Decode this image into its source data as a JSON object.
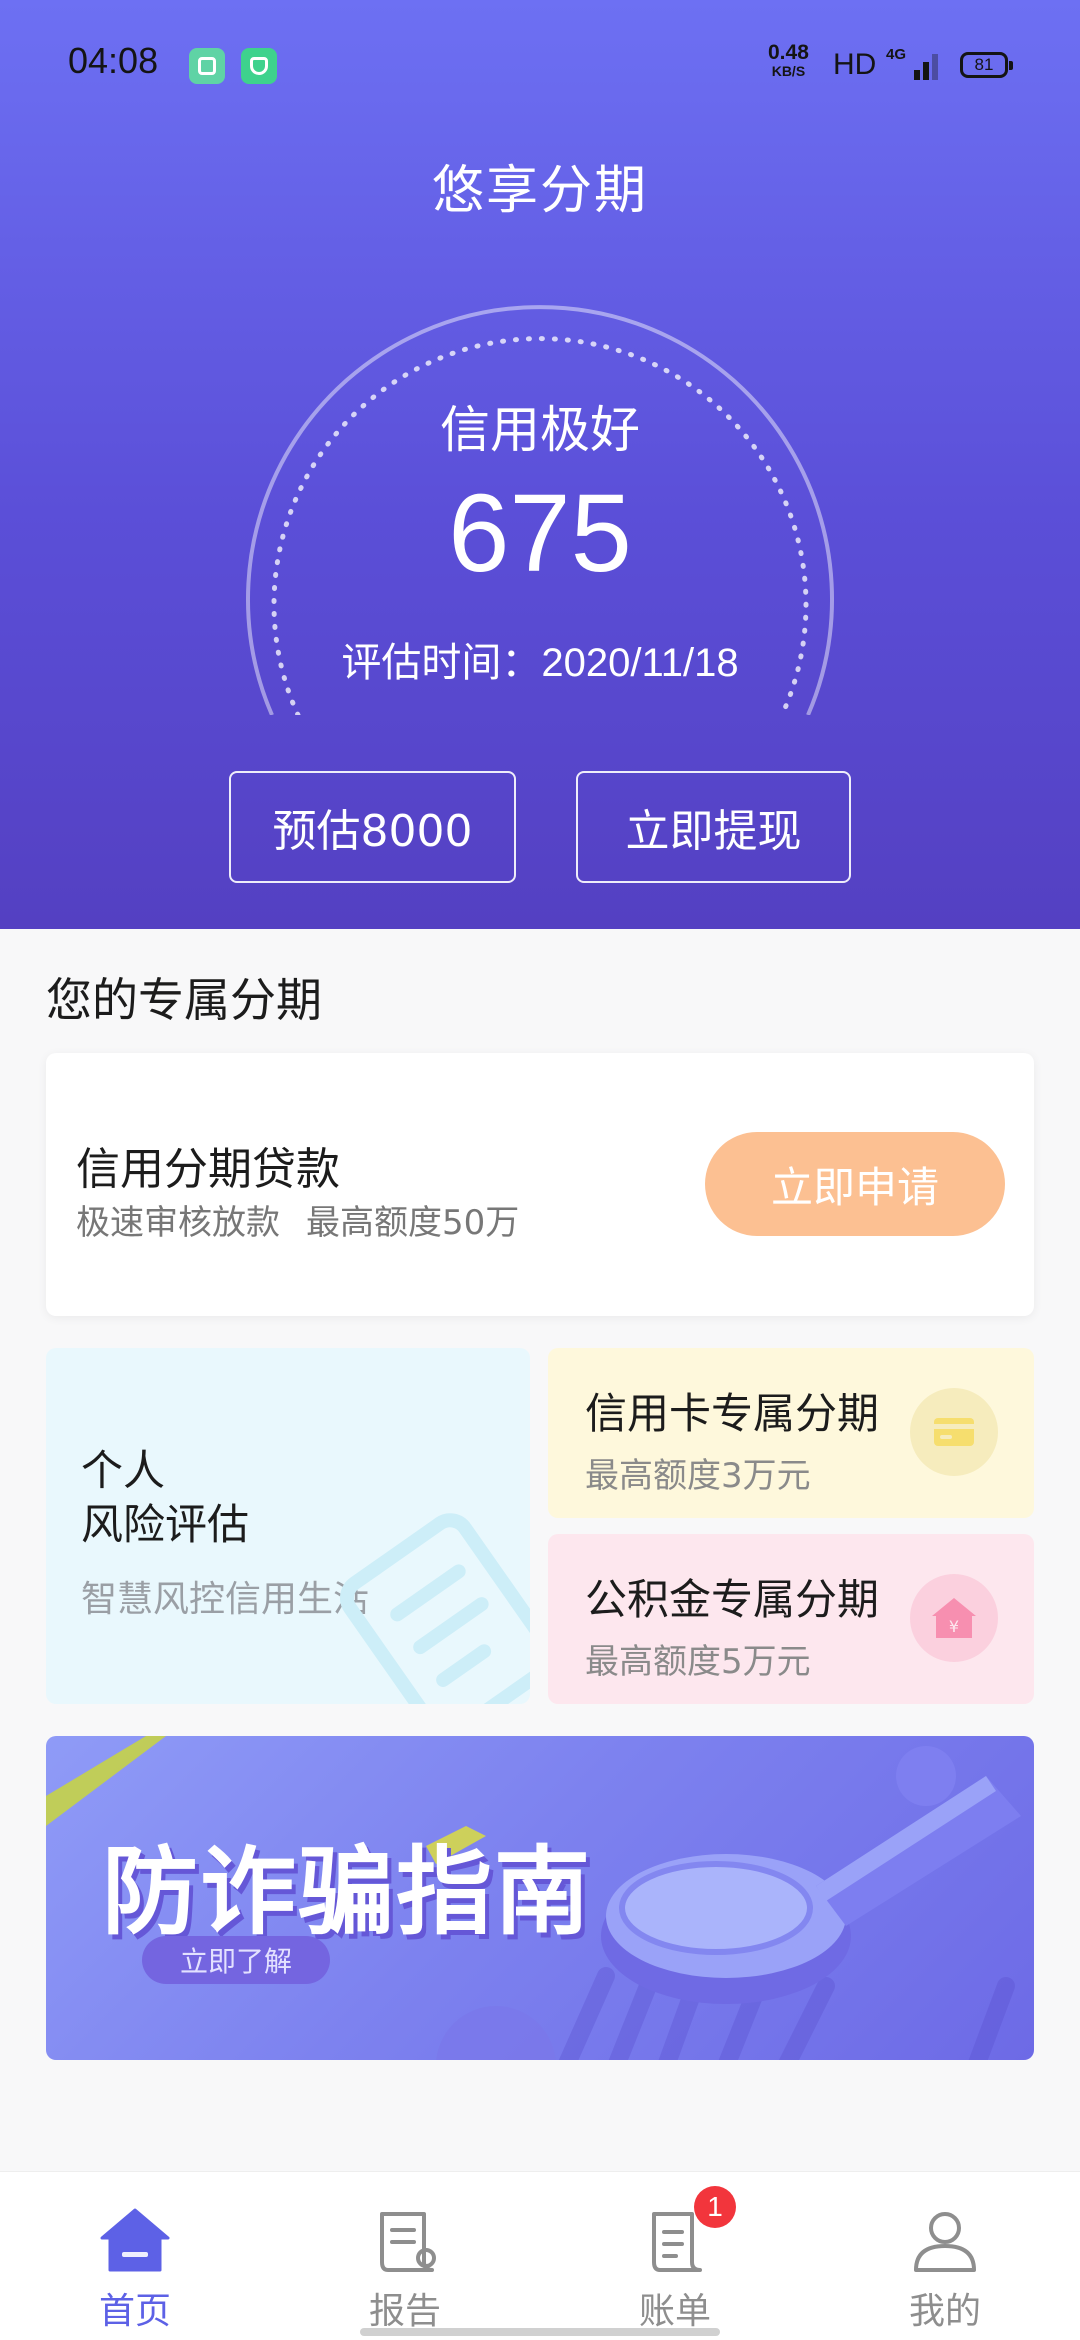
{
  "status_bar": {
    "time": "04:08",
    "speed_value": "0.48",
    "speed_unit": "KB/S",
    "hd": "HD",
    "network": "4G",
    "battery": "81"
  },
  "header": {
    "title": "悠享分期",
    "credit_label": "信用极好",
    "credit_score": "675",
    "eval_prefix": "评估时间：",
    "eval_date": "2020/11/18",
    "estimate_button": "预估8000",
    "withdraw_button": "立即提现"
  },
  "section": {
    "title": "您的专属分期"
  },
  "loan_card": {
    "title": "信用分期贷款",
    "sub_1": "极速审核放款",
    "sub_2": "最高额度50万",
    "apply_button": "立即申请"
  },
  "risk_card": {
    "title_line1": "个人",
    "title_line2": "风险评估",
    "subtitle": "智慧风控信用生活"
  },
  "credit_card_installment": {
    "title": "信用卡专属分期",
    "subtitle": "最高额度3万元",
    "icon": "credit-card-icon"
  },
  "fund_installment": {
    "title": "公积金专属分期",
    "subtitle": "最高额度5万元",
    "icon": "house-yuan-icon"
  },
  "banner": {
    "title": "防诈骗指南",
    "button": "立即了解"
  },
  "bottom_nav": {
    "items": [
      {
        "label": "首页",
        "icon": "home-icon",
        "active": true
      },
      {
        "label": "报告",
        "icon": "report-icon",
        "active": false
      },
      {
        "label": "账单",
        "icon": "bill-icon",
        "active": false,
        "badge": "1"
      },
      {
        "label": "我的",
        "icon": "user-icon",
        "active": false
      }
    ]
  },
  "colors": {
    "primary": "#5d61e6",
    "header_gradient_top": "#6d70f3",
    "header_gradient_bottom": "#5440c2",
    "apply_button": "#fcc092",
    "badge": "#f2353c"
  }
}
